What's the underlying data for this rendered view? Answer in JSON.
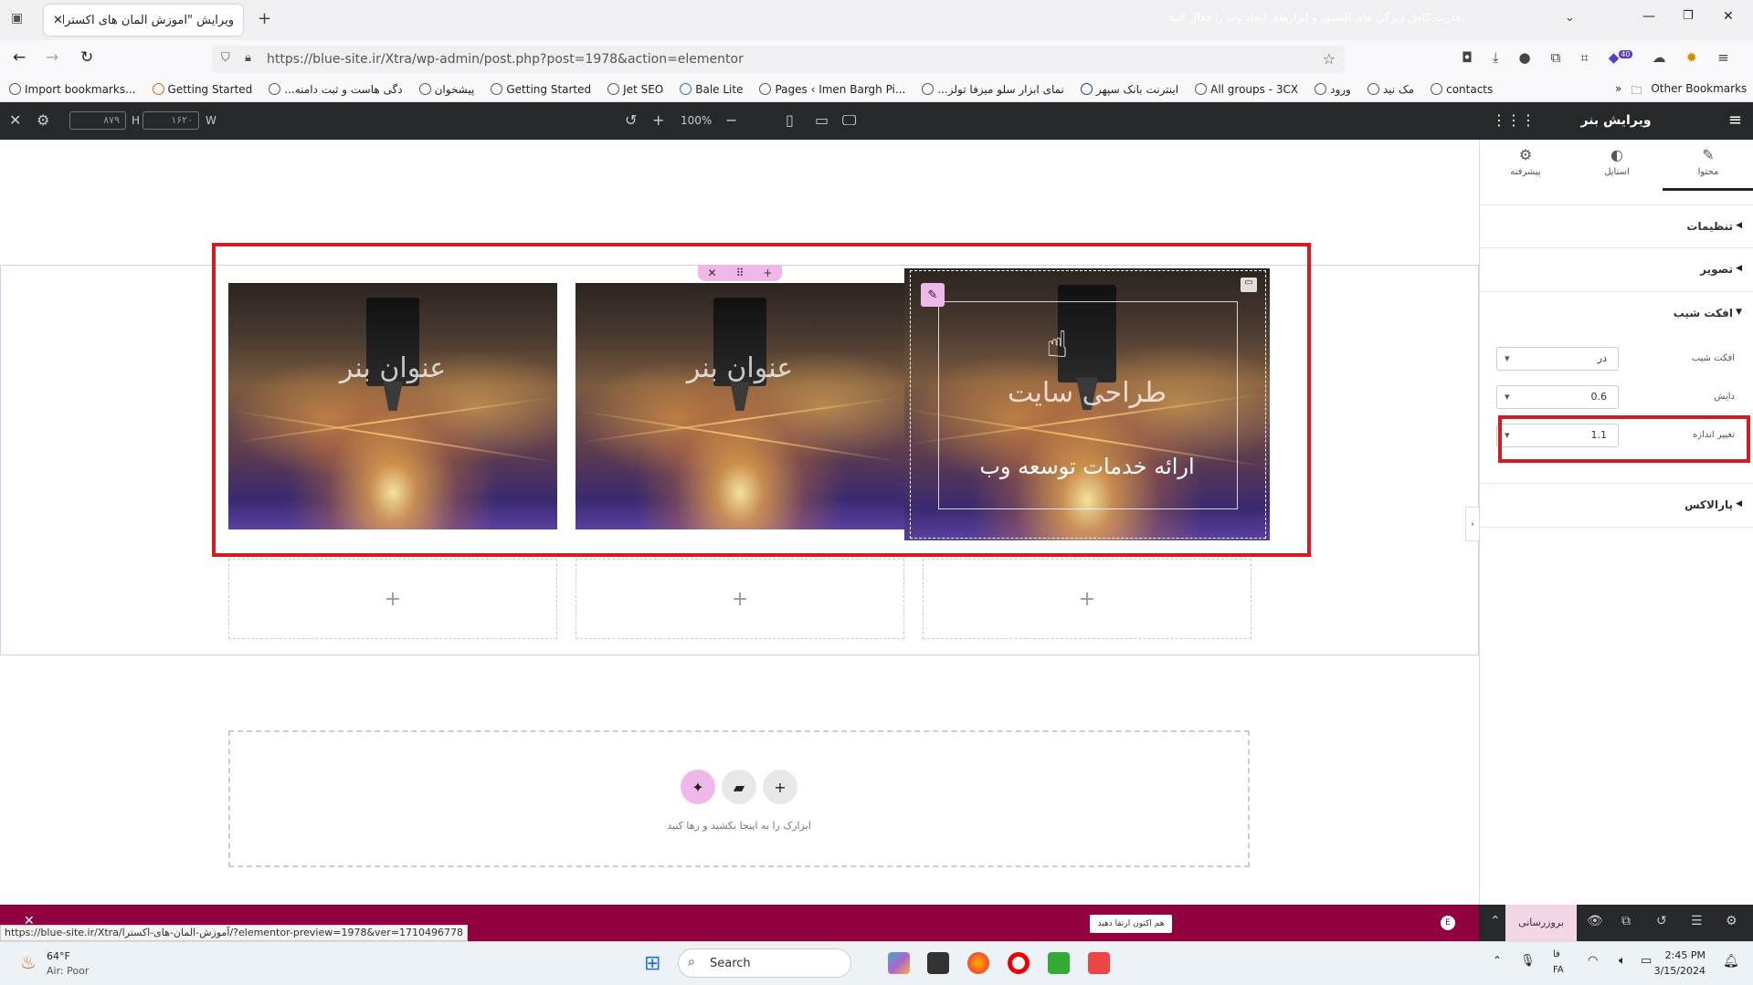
{
  "browser": {
    "tab_title": "ویرایش \"آموزش المان های اکسترا -",
    "url": "https://blue-site.ir/Xtra/wp-admin/post.php?post=1978&action=elementor",
    "bookmarks": [
      "Import bookmarks...",
      "Getting Started",
      "...دگی هاست و ثبت دامنه",
      "پیشخوان",
      "Getting Started",
      "Jet SEO",
      "Bale Lite",
      "Pages ‹ Imen Bargh Pi...",
      "...نمای ابزار سلو میزفا تولز",
      "اینترنت بانک سپهر",
      "All groups - 3CX",
      "ورود",
      "مک نید",
      "contacts"
    ],
    "other_bookmarks": "Other Bookmarks",
    "badge_count": "40"
  },
  "editor_top": {
    "height_value": "۸۷۹",
    "height_label": "H",
    "width_value": "۱۶۲۰",
    "width_label": "W",
    "zoom": "100%"
  },
  "banners": [
    {
      "title": "عنوان بنر",
      "subtitle": ""
    },
    {
      "title": "عنوان بنر",
      "subtitle": ""
    },
    {
      "title": "طراحی سایت",
      "subtitle": "ارائه خدمات توسعه وب"
    }
  ],
  "drop_area": {
    "text": "ابزارک را به اینجا بکشید و رها کنید",
    "plus": "+"
  },
  "promo": {
    "text": "قدرت کامل ویژگی های المنتور و ابزارهای ایجاد وب را فعال کنید.",
    "button": "هم اکنون ارتقا دهید",
    "update": "بروزرسانی"
  },
  "status_url": "https://blue-site.ir/Xtra/آموزش-المان-های-اکسترا/?elementor-preview=1978&ver=1710496778",
  "panel": {
    "title": "ویرایش بنر",
    "tabs": [
      "محتوا",
      "استایل",
      "پیشرفته"
    ],
    "sections": [
      "تنظیمات",
      "تصویر",
      "افکت شیب",
      "پارالاکس"
    ],
    "controls": [
      {
        "label": "افکت شیب",
        "value": "در"
      },
      {
        "label": "دایش",
        "value": "0.6"
      },
      {
        "label": "تغییر اندازه",
        "value": "1.1"
      }
    ]
  },
  "taskbar": {
    "temp": "64°F",
    "air": "Air: Poor",
    "search": "Search",
    "lang_top": "فا",
    "lang_bottom": "FA",
    "time": "2:45 PM",
    "date": "3/15/2024"
  }
}
